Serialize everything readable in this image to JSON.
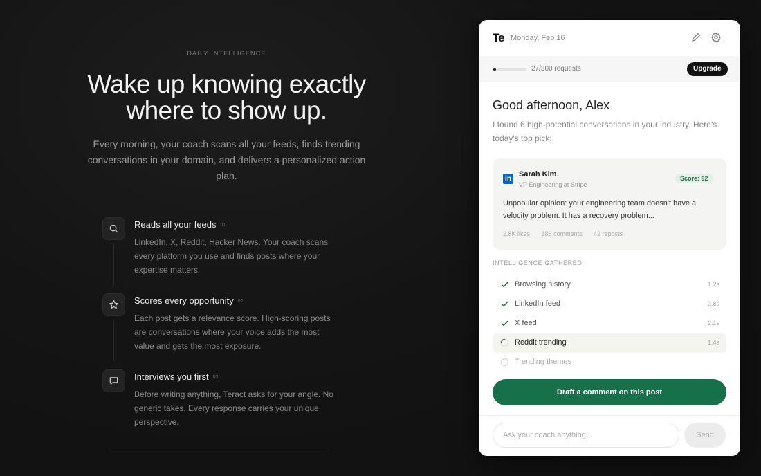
{
  "hero": {
    "eyebrow": "DAILY INTELLIGENCE",
    "headline_line1": "Wake up knowing exactly",
    "headline_line2": "where to show up.",
    "subtitle": "Every morning, your coach scans all your feeds, finds trending conversations in your domain, and delivers a personalized action plan."
  },
  "steps": [
    {
      "title": "Reads all your feeds",
      "num": "01",
      "icon": "search-icon",
      "desc": "LinkedIn, X, Reddit, Hacker News. Your coach scans every platform you use and finds posts where your expertise matters."
    },
    {
      "title": "Scores every opportunity",
      "num": "02",
      "icon": "star-icon",
      "desc": "Each post gets a relevance score. High-scoring posts are conversations where your voice adds the most value and gets the most exposure."
    },
    {
      "title": "Interviews you first",
      "num": "03",
      "icon": "chat-icon",
      "desc": "Before writing anything, Teract asks for your angle. No generic takes. Every response carries your unique perspective."
    }
  ],
  "card": {
    "logo": "Te",
    "date": "Monday, Feb 16",
    "usage": {
      "text": "27/300 requests",
      "fraction": 0.09
    },
    "upgrade_label": "Upgrade",
    "greeting": "Good afternoon, Alex",
    "intro": "I found 6 high-potential conversations in your industry. Here's today's top pick:",
    "post": {
      "platform_icon": "linkedin-icon",
      "author": "Sarah Kim",
      "role": "VP Engineering at Stripe",
      "score": "Score: 92",
      "text": "Unpopular opinion: your engineering team doesn't have a velocity problem. It has a recovery problem...",
      "likes": "2.8K likes",
      "comments": "186 comments",
      "reposts": "42 reposts"
    },
    "intel_label": "INTELLIGENCE GATHERED",
    "intel_items": [
      {
        "label": "Browsing history",
        "time": "1.2s",
        "state": "done"
      },
      {
        "label": "LinkedIn feed",
        "time": "3.8s",
        "state": "done"
      },
      {
        "label": "X feed",
        "time": "2.1s",
        "state": "done"
      },
      {
        "label": "Reddit trending",
        "time": "1.4s",
        "state": "active"
      },
      {
        "label": "Trending themes",
        "time": "",
        "state": "pending"
      }
    ],
    "draft_label": "Draft a comment on this post",
    "ask_placeholder": "Ask your coach anything...",
    "send_label": "Send"
  },
  "colors": {
    "accent": "#16704a",
    "background": "#121212",
    "score_bg": "#e4efe6"
  }
}
